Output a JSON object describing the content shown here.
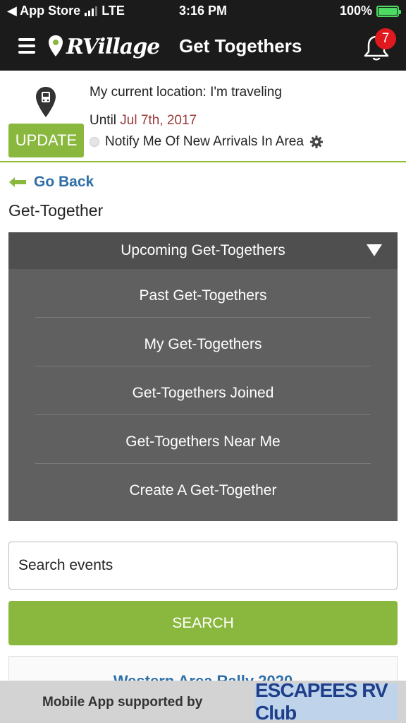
{
  "status_bar": {
    "back_app": "◀ App Store",
    "carrier": "LTE",
    "time": "3:16 PM",
    "battery": "100%",
    "battery_level": 1.0
  },
  "header": {
    "brand": "RVillage",
    "title": "Get Togethers",
    "notification_count": "7"
  },
  "location": {
    "current_text": "My current location: I'm traveling",
    "until_label": "Until",
    "until_date": "Jul 7th, 2017",
    "update_label": "UPDATE",
    "notify_label": "Notify Me Of New Arrivals In Area"
  },
  "nav": {
    "go_back": "Go Back",
    "page_title": "Get-Together"
  },
  "menu": {
    "selected": "Upcoming Get-Togethers",
    "items": [
      {
        "label": "Past Get-Togethers"
      },
      {
        "label": "My Get-Togethers"
      },
      {
        "label": "Get-Togethers Joined"
      },
      {
        "label": "Get-Togethers Near Me"
      },
      {
        "label": "Create A Get-Together"
      }
    ]
  },
  "search": {
    "placeholder": "Search events",
    "button_label": "SEARCH"
  },
  "event_preview": {
    "name": "Western Area Rally 2020"
  },
  "footer": {
    "supported_text": "Mobile App supported by",
    "sponsor": "ESCAPEES RV Club"
  },
  "colors": {
    "brand_green": "#8ab83e",
    "link_blue": "#2f6fa8",
    "date_red": "#9b3a3a",
    "header_bg": "#1b1b1b",
    "badge_red": "#e0191f"
  }
}
